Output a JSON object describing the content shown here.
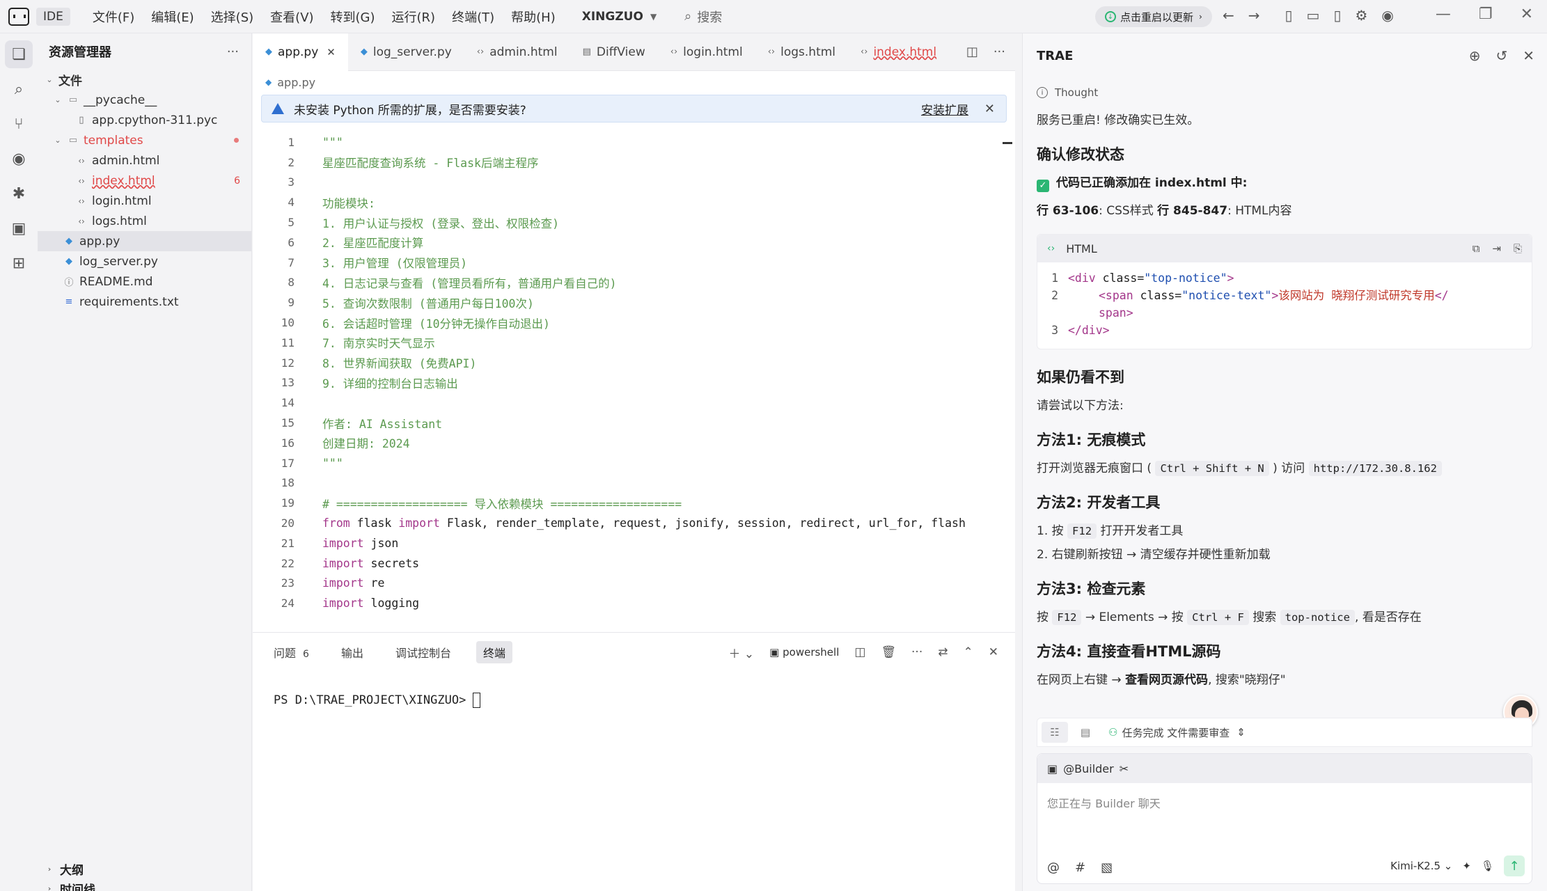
{
  "titlebar": {
    "ide_label": "IDE",
    "menu": [
      "文件(F)",
      "编辑(E)",
      "选择(S)",
      "查看(V)",
      "转到(G)",
      "运行(R)",
      "终端(T)",
      "帮助(H)"
    ],
    "project": "XINGZUO",
    "search_placeholder": "搜索",
    "update_label": "点击重启以更新"
  },
  "sidebar": {
    "title": "资源管理器",
    "root": "文件",
    "items": [
      {
        "label": "__pycache__",
        "type": "folder",
        "depth": 1
      },
      {
        "label": "app.cpython-311.pyc",
        "type": "file",
        "depth": 2
      },
      {
        "label": "templates",
        "type": "folder",
        "depth": 1
      },
      {
        "label": "admin.html",
        "type": "html",
        "depth": 2
      },
      {
        "label": "index.html",
        "type": "html",
        "depth": 2,
        "badge": "6"
      },
      {
        "label": "login.html",
        "type": "html",
        "depth": 2
      },
      {
        "label": "logs.html",
        "type": "html",
        "depth": 2
      },
      {
        "label": "app.py",
        "type": "py",
        "depth": 1
      },
      {
        "label": "log_server.py",
        "type": "py",
        "depth": 1
      },
      {
        "label": "README.md",
        "type": "info",
        "depth": 1
      },
      {
        "label": "requirements.txt",
        "type": "txt",
        "depth": 1
      }
    ],
    "outline": "大纲",
    "timeline": "时间线"
  },
  "editor": {
    "tabs": [
      "app.py",
      "log_server.py",
      "admin.html",
      "DiffView",
      "login.html",
      "logs.html",
      "index.html"
    ],
    "breadcrumb": "app.py",
    "banner_text": "未安装 Python 所需的扩展，是否需要安装?",
    "banner_action": "安装扩展",
    "code_lines": [
      {
        "n": "1",
        "t": "\"\"\"",
        "c": "cmt"
      },
      {
        "n": "2",
        "t": "星座匹配度查询系统 - Flask后端主程序",
        "c": "cmt"
      },
      {
        "n": "3",
        "t": "",
        "c": "cmt"
      },
      {
        "n": "4",
        "t": "功能模块:",
        "c": "cmt"
      },
      {
        "n": "5",
        "t": "1. 用户认证与授权 (登录、登出、权限检查)",
        "c": "cmt"
      },
      {
        "n": "6",
        "t": "2. 星座匹配度计算",
        "c": "cmt"
      },
      {
        "n": "7",
        "t": "3. 用户管理 (仅限管理员)",
        "c": "cmt"
      },
      {
        "n": "8",
        "t": "4. 日志记录与查看 (管理员看所有，普通用户看自己的)",
        "c": "cmt"
      },
      {
        "n": "9",
        "t": "5. 查询次数限制 (普通用户每日100次)",
        "c": "cmt"
      },
      {
        "n": "10",
        "t": "6. 会话超时管理 (10分钟无操作自动退出)",
        "c": "cmt"
      },
      {
        "n": "11",
        "t": "7. 南京实时天气显示",
        "c": "cmt"
      },
      {
        "n": "12",
        "t": "8. 世界新闻获取 (免费API)",
        "c": "cmt"
      },
      {
        "n": "13",
        "t": "9. 详细的控制台日志输出",
        "c": "cmt"
      },
      {
        "n": "14",
        "t": "",
        "c": "cmt"
      },
      {
        "n": "15",
        "t": "作者: AI Assistant",
        "c": "cmt"
      },
      {
        "n": "16",
        "t": "创建日期: 2024",
        "c": "cmt"
      },
      {
        "n": "17",
        "t": "\"\"\"",
        "c": "cmt"
      },
      {
        "n": "18",
        "t": "",
        "c": "plain"
      },
      {
        "n": "19",
        "t": "# =================== 导入依赖模块 ===================",
        "c": "cmt"
      },
      {
        "n": "20",
        "kw": "from",
        "t": " flask ",
        "kw2": "import",
        "t2": " Flask, render_template, request, jsonify, session, redirect, url_for, flash"
      },
      {
        "n": "21",
        "kw": "import",
        "t": " json"
      },
      {
        "n": "22",
        "kw": "import",
        "t": " secrets"
      },
      {
        "n": "23",
        "kw": "import",
        "t": " re"
      },
      {
        "n": "24",
        "kw": "import",
        "t": " logging"
      }
    ]
  },
  "panel": {
    "tabs": [
      "问题",
      "输出",
      "调试控制台",
      "终端"
    ],
    "problems_count": "6",
    "shell": "powershell",
    "prompt": "PS D:\\TRAE_PROJECT\\XINGZUO>"
  },
  "chat": {
    "title": "TRAE",
    "thought": "Thought",
    "p1": "服务已重启! 修改确实已生效。",
    "h_confirm": "确认修改状态",
    "check_text": "代码已正确添加在 index.html 中:",
    "lines_a": "行 63-106",
    "lines_a_desc": ": CSS样式 ",
    "lines_b": "行 845-847",
    "lines_b_desc": ": HTML内容",
    "codeblock_lang": "HTML",
    "cb_line1_tag": "<div",
    "cb_line1_attr": " class=",
    "cb_line1_str": "\"top-notice\"",
    "cb_line1_end": ">",
    "cb_line2_tag": "<span",
    "cb_line2_attr": " class=",
    "cb_line2_str": "\"notice-text\"",
    "cb_line2_gt": ">",
    "cb_line2_txt": "该网站为 晓翔仔测试研究专用",
    "cb_line2_close": "</",
    "cb_line2b": "span>",
    "cb_line3": "</div>",
    "h_if": "如果仍看不到",
    "try": "请尝试以下方法:",
    "m1_title": "方法1: 无痕模式",
    "m1_a": "打开浏览器无痕窗口 (",
    "m1_keys": "Ctrl + Shift + N",
    "m1_b": ") 访问",
    "m1_url": "http://172.30.8.162",
    "m2_title": "方法2: 开发者工具",
    "m2_1a": "1. 按",
    "m2_key": "F12",
    "m2_1b": "打开开发者工具",
    "m2_2": "2. 右键刷新按钮 → 清空缓存并硬性重新加载",
    "m3_title": "方法3: 检查元素",
    "m3_a": "按",
    "m3_key1": "F12",
    "m3_b": "→ Elements → 按",
    "m3_key2": "Ctrl + F",
    "m3_c": "搜索",
    "m3_key3": "top-notice",
    "m3_d": ", 看是否存在",
    "m4_title": "方法4: 直接查看HTML源码",
    "m4_a": "在网页上右键 →",
    "m4_b": "查看网页源代码",
    "m4_c": ", 搜索\"晓翔仔\"",
    "task_status": "任务完成 文件需要审查",
    "builder": "@Builder",
    "input_placeholder": "您正在与 Builder 聊天",
    "model": "Kimi-K2.5"
  },
  "colors": {
    "accent_green": "#2bb673",
    "comment": "#5b9a4f",
    "keyword": "#a3368a",
    "error_red": "#e04848"
  }
}
